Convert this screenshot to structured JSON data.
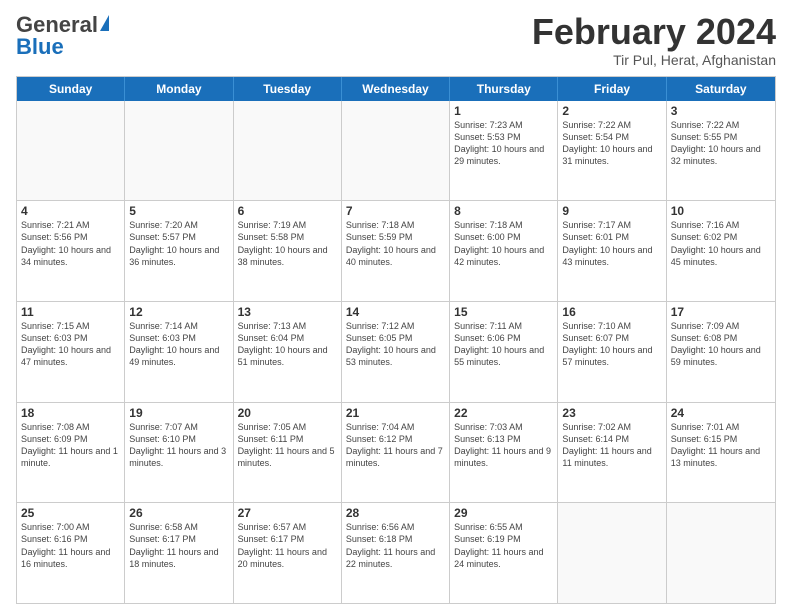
{
  "header": {
    "logo_general": "General",
    "logo_blue": "Blue",
    "title": "February 2024",
    "subtitle": "Tir Pul, Herat, Afghanistan"
  },
  "days_of_week": [
    "Sunday",
    "Monday",
    "Tuesday",
    "Wednesday",
    "Thursday",
    "Friday",
    "Saturday"
  ],
  "weeks": [
    [
      {
        "day": "",
        "info": ""
      },
      {
        "day": "",
        "info": ""
      },
      {
        "day": "",
        "info": ""
      },
      {
        "day": "",
        "info": ""
      },
      {
        "day": "1",
        "info": "Sunrise: 7:23 AM\nSunset: 5:53 PM\nDaylight: 10 hours and 29 minutes."
      },
      {
        "day": "2",
        "info": "Sunrise: 7:22 AM\nSunset: 5:54 PM\nDaylight: 10 hours and 31 minutes."
      },
      {
        "day": "3",
        "info": "Sunrise: 7:22 AM\nSunset: 5:55 PM\nDaylight: 10 hours and 32 minutes."
      }
    ],
    [
      {
        "day": "4",
        "info": "Sunrise: 7:21 AM\nSunset: 5:56 PM\nDaylight: 10 hours and 34 minutes."
      },
      {
        "day": "5",
        "info": "Sunrise: 7:20 AM\nSunset: 5:57 PM\nDaylight: 10 hours and 36 minutes."
      },
      {
        "day": "6",
        "info": "Sunrise: 7:19 AM\nSunset: 5:58 PM\nDaylight: 10 hours and 38 minutes."
      },
      {
        "day": "7",
        "info": "Sunrise: 7:18 AM\nSunset: 5:59 PM\nDaylight: 10 hours and 40 minutes."
      },
      {
        "day": "8",
        "info": "Sunrise: 7:18 AM\nSunset: 6:00 PM\nDaylight: 10 hours and 42 minutes."
      },
      {
        "day": "9",
        "info": "Sunrise: 7:17 AM\nSunset: 6:01 PM\nDaylight: 10 hours and 43 minutes."
      },
      {
        "day": "10",
        "info": "Sunrise: 7:16 AM\nSunset: 6:02 PM\nDaylight: 10 hours and 45 minutes."
      }
    ],
    [
      {
        "day": "11",
        "info": "Sunrise: 7:15 AM\nSunset: 6:03 PM\nDaylight: 10 hours and 47 minutes."
      },
      {
        "day": "12",
        "info": "Sunrise: 7:14 AM\nSunset: 6:03 PM\nDaylight: 10 hours and 49 minutes."
      },
      {
        "day": "13",
        "info": "Sunrise: 7:13 AM\nSunset: 6:04 PM\nDaylight: 10 hours and 51 minutes."
      },
      {
        "day": "14",
        "info": "Sunrise: 7:12 AM\nSunset: 6:05 PM\nDaylight: 10 hours and 53 minutes."
      },
      {
        "day": "15",
        "info": "Sunrise: 7:11 AM\nSunset: 6:06 PM\nDaylight: 10 hours and 55 minutes."
      },
      {
        "day": "16",
        "info": "Sunrise: 7:10 AM\nSunset: 6:07 PM\nDaylight: 10 hours and 57 minutes."
      },
      {
        "day": "17",
        "info": "Sunrise: 7:09 AM\nSunset: 6:08 PM\nDaylight: 10 hours and 59 minutes."
      }
    ],
    [
      {
        "day": "18",
        "info": "Sunrise: 7:08 AM\nSunset: 6:09 PM\nDaylight: 11 hours and 1 minute."
      },
      {
        "day": "19",
        "info": "Sunrise: 7:07 AM\nSunset: 6:10 PM\nDaylight: 11 hours and 3 minutes."
      },
      {
        "day": "20",
        "info": "Sunrise: 7:05 AM\nSunset: 6:11 PM\nDaylight: 11 hours and 5 minutes."
      },
      {
        "day": "21",
        "info": "Sunrise: 7:04 AM\nSunset: 6:12 PM\nDaylight: 11 hours and 7 minutes."
      },
      {
        "day": "22",
        "info": "Sunrise: 7:03 AM\nSunset: 6:13 PM\nDaylight: 11 hours and 9 minutes."
      },
      {
        "day": "23",
        "info": "Sunrise: 7:02 AM\nSunset: 6:14 PM\nDaylight: 11 hours and 11 minutes."
      },
      {
        "day": "24",
        "info": "Sunrise: 7:01 AM\nSunset: 6:15 PM\nDaylight: 11 hours and 13 minutes."
      }
    ],
    [
      {
        "day": "25",
        "info": "Sunrise: 7:00 AM\nSunset: 6:16 PM\nDaylight: 11 hours and 16 minutes."
      },
      {
        "day": "26",
        "info": "Sunrise: 6:58 AM\nSunset: 6:17 PM\nDaylight: 11 hours and 18 minutes."
      },
      {
        "day": "27",
        "info": "Sunrise: 6:57 AM\nSunset: 6:17 PM\nDaylight: 11 hours and 20 minutes."
      },
      {
        "day": "28",
        "info": "Sunrise: 6:56 AM\nSunset: 6:18 PM\nDaylight: 11 hours and 22 minutes."
      },
      {
        "day": "29",
        "info": "Sunrise: 6:55 AM\nSunset: 6:19 PM\nDaylight: 11 hours and 24 minutes."
      },
      {
        "day": "",
        "info": ""
      },
      {
        "day": "",
        "info": ""
      }
    ]
  ]
}
